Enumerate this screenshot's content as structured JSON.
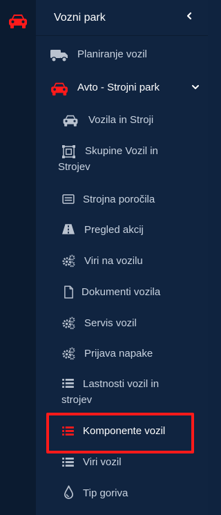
{
  "colors": {
    "rail_bg": "#0b1b30",
    "panel_bg": "#102440",
    "text": "#c9d3e0",
    "text_bright": "#ffffff",
    "accent_red": "#ff1a1a",
    "icon_grey": "#b9c2cf"
  },
  "rail": {
    "icon": "car-icon"
  },
  "header": {
    "title": "Vozni park",
    "collapse_icon": "chevron-left-icon"
  },
  "menu": {
    "planning": {
      "label": "Planiranje vozil",
      "icon": "truck-icon"
    },
    "parent": {
      "label": "Avto - Strojni park",
      "icon": "car-icon",
      "expanded_icon": "chevron-down-icon"
    },
    "children": [
      {
        "label": "Vozila in Stroji",
        "icon": "car-icon"
      },
      {
        "label_line1": "Skupine Vozil in",
        "label_line2": "Strojev",
        "icon": "object-group-icon"
      },
      {
        "label": "Strojna poročila",
        "icon": "card-icon"
      },
      {
        "label": "Pregled akcij",
        "icon": "road-icon"
      },
      {
        "label": "Viri na vozilu",
        "icon": "gears-icon"
      },
      {
        "label": "Dokumenti vozila",
        "icon": "document-icon"
      },
      {
        "label": "Servis vozil",
        "icon": "gears-icon"
      },
      {
        "label": "Prijava napake",
        "icon": "gears-icon"
      },
      {
        "label_line1": "Lastnosti vozil in",
        "label_line2": "strojev",
        "icon": "list-icon"
      },
      {
        "label": "Komponente vozil",
        "icon": "list-icon",
        "active": true
      },
      {
        "label": "Viri vozil",
        "icon": "list-icon"
      },
      {
        "label": "Tip goriva",
        "icon": "drop-icon"
      }
    ]
  }
}
